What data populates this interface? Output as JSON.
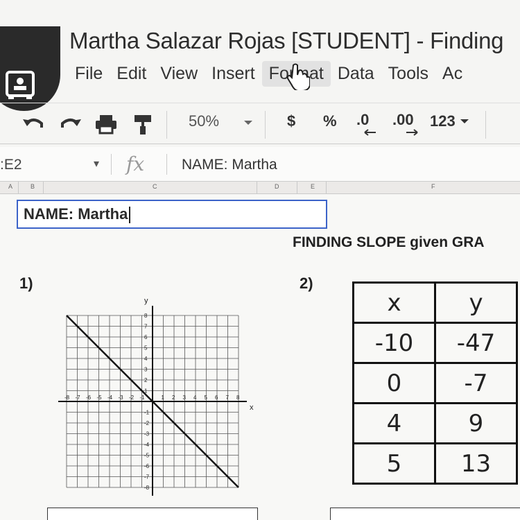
{
  "window": {
    "title": "Martha Salazar Rojas [STUDENT] - Finding"
  },
  "menubar": {
    "items": [
      "File",
      "Edit",
      "View",
      "Insert",
      "Format",
      "Data",
      "Tools",
      "Ac"
    ],
    "active": "Format"
  },
  "toolbar": {
    "zoom": "50%",
    "currency": "$",
    "percent": "%",
    "decrease_decimals": ".0",
    "increase_decimals": ".00",
    "more_formats": "123"
  },
  "formula_bar": {
    "name_box": ":E2",
    "fx": "fx",
    "value": "NAME: Martha"
  },
  "columns": [
    "A",
    "B",
    "C",
    "D",
    "E",
    "F"
  ],
  "cell": {
    "text": "NAME: Martha"
  },
  "worksheet": {
    "heading": "FINDING SLOPE given GRA",
    "q1": "1)",
    "q2": "2)",
    "graph": {
      "axis_x": "x",
      "axis_y": "y",
      "x_ticks": [
        "-8",
        "-7",
        "-6",
        "-5",
        "-4",
        "-3",
        "-2",
        "-1",
        "1",
        "2",
        "3",
        "4",
        "5",
        "6",
        "7",
        "8"
      ],
      "y_ticks": [
        "8",
        "7",
        "6",
        "5",
        "4",
        "3",
        "2",
        "1",
        "-1",
        "-2",
        "-3",
        "-4",
        "-5",
        "-6",
        "-7",
        "-8"
      ],
      "line": {
        "from": [
          -8,
          8
        ],
        "to": [
          8,
          -8
        ]
      }
    },
    "table": {
      "headers": [
        "x",
        "y"
      ],
      "rows": [
        [
          "-10",
          "-47"
        ],
        [
          "0",
          "-7"
        ],
        [
          "4",
          "9"
        ],
        [
          "5",
          "13"
        ]
      ]
    }
  }
}
